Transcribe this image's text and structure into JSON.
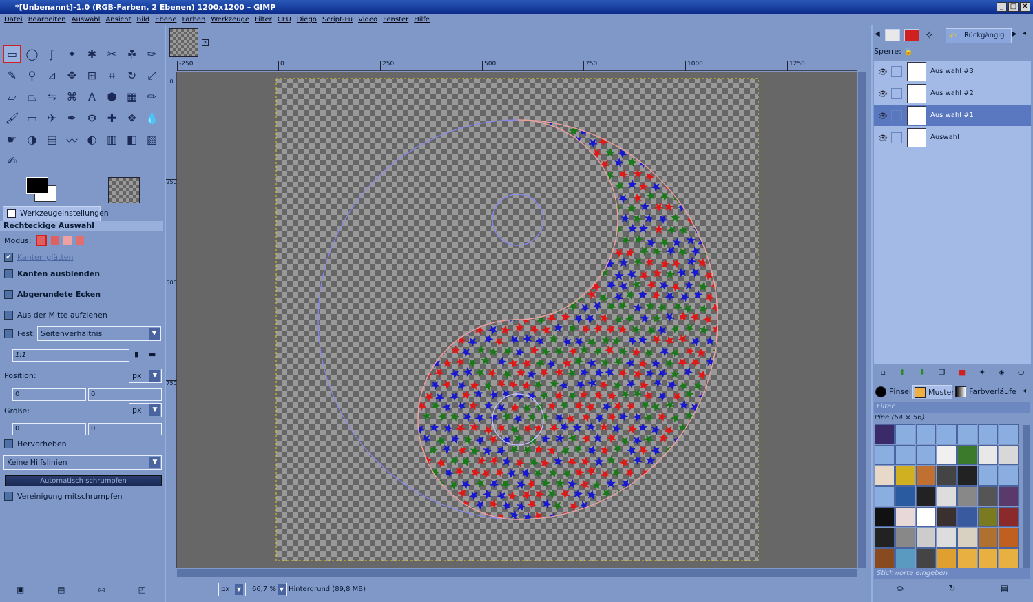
{
  "window": {
    "title": "*[Unbenannt]-1.0 (RGB-Farben, 2 Ebenen) 1200x1200 – GIMP"
  },
  "menu": [
    "Datei",
    "Bearbeiten",
    "Auswahl",
    "Ansicht",
    "Bild",
    "Ebene",
    "Farben",
    "Werkzeuge",
    "Filter",
    "CFU",
    "Diego",
    "Script-Fu",
    "Video",
    "Fenster",
    "Hilfe"
  ],
  "tools": [
    "rect-select-icon",
    "ellipse-select-icon",
    "free-select-icon",
    "fuzzy-select-icon",
    "color-select-icon",
    "scissors-icon",
    "foreground-select-icon",
    "paths-icon",
    "color-picker-icon",
    "zoom-icon",
    "measure-icon",
    "move-icon",
    "align-icon",
    "crop-icon",
    "rotate-icon",
    "scale-icon",
    "shear-icon",
    "perspective-icon",
    "flip-icon",
    "cage-icon",
    "text-icon",
    "bucket-fill-icon",
    "blend-icon",
    "pencil-icon",
    "paintbrush-icon",
    "eraser-icon",
    "airbrush-icon",
    "ink-icon",
    "clone-icon",
    "heal-icon",
    "perspective-clone-icon",
    "blur-icon",
    "smudge-icon",
    "dodge-burn-icon",
    "levels-icon",
    "curves-icon",
    "hue-saturation-icon",
    "color-balance-icon",
    "threshold-icon",
    "histogram-icon",
    "warp-icon"
  ],
  "tool_glyphs": [
    "▭",
    "◯",
    "ʃ",
    "✦",
    "✱",
    "✂",
    "☘",
    "✑",
    "✎",
    "⚲",
    "⊿",
    "✥",
    "⊞",
    "⌗",
    "↻",
    "⤢",
    "▱",
    "⏢",
    "⇋",
    "⌘",
    "A",
    "⬢",
    "▦",
    "✏",
    "🖌",
    "▭",
    "✈",
    "✒",
    "⚙",
    "✚",
    "❖",
    "💧",
    "☛",
    "◑",
    "▤",
    "〰",
    "◐",
    "▥",
    "◧",
    "▧",
    "✍"
  ],
  "tooloptions": {
    "tab_label": "Werkzeugeinstellungen",
    "header": "Rechteckige Auswahl",
    "modus_label": "Modus:",
    "kanten_glaetten": "Kanten glätten",
    "kanten_ausblenden": "Kanten ausblenden",
    "abgerundete_ecken": "Abgerundete Ecken",
    "aus_der_mitte": "Aus der Mitte aufziehen",
    "fest_label": "Fest:",
    "fest_value": "Seitenverhältnis",
    "ratio": "1:1",
    "position_label": "Position:",
    "position_unit": "px",
    "pos_x": "0",
    "pos_y": "0",
    "groesse_label": "Größe:",
    "groesse_unit": "px",
    "size_w": "0",
    "size_h": "0",
    "hervorheben": "Hervorheben",
    "hilfslinien": "Keine Hilfslinien",
    "auto_shrink": "Automatisch schrumpfen",
    "vereinigung": "Vereinigung mitschrumpfen"
  },
  "ruler": {
    "h": [
      "-250",
      "0",
      "250",
      "500",
      "750",
      "1000",
      "1250"
    ],
    "v": [
      "0",
      "250",
      "500",
      "750"
    ]
  },
  "status": {
    "unit": "px",
    "zoom": "66,7 %",
    "info": "Hintergrund (89,8 MB)"
  },
  "right": {
    "undo_tab": "Rückgängig",
    "lock_label": "Sperre:",
    "layers": [
      {
        "name": "Aus wahl #3",
        "selected": false
      },
      {
        "name": "Aus wahl #2",
        "selected": false
      },
      {
        "name": "Aus wahl #1",
        "selected": true
      },
      {
        "name": "Auswahl",
        "selected": false
      }
    ],
    "tab_pinsel": "Pinsel",
    "tab_muster": "Muster",
    "tab_verlaeufe": "Farbverläufe",
    "filter_placeholder": "Filter",
    "pattern_name": "Pine (64 × 56)",
    "tags_placeholder": "Stichworte eingeben"
  },
  "colors": {
    "star_red": "#e01818",
    "star_green": "#1a7a1a",
    "star_blue": "#1818d0",
    "canvas_bg": "#676767",
    "accent": "#7f98c8"
  }
}
